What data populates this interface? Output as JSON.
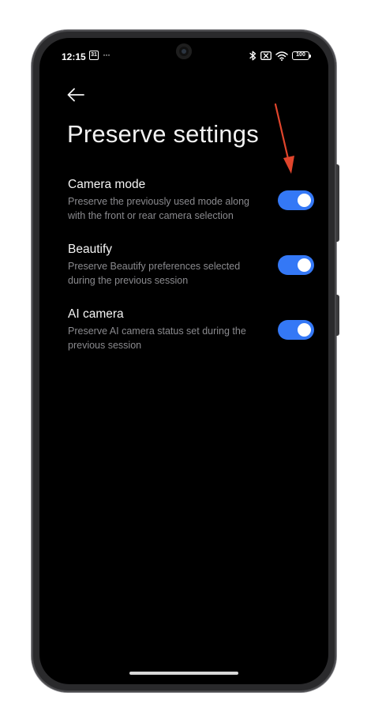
{
  "status_bar": {
    "time": "12:15",
    "calendar_day": "31",
    "more": "···",
    "battery_level": "100"
  },
  "page": {
    "title": "Preserve settings"
  },
  "settings": [
    {
      "title": "Camera mode",
      "description": "Preserve the previously used mode along with the front or rear camera selection",
      "enabled": true
    },
    {
      "title": "Beautify",
      "description": "Preserve Beautify preferences selected during the previous session",
      "enabled": true
    },
    {
      "title": "AI camera",
      "description": "Preserve AI camera status set during the previous session",
      "enabled": true
    }
  ],
  "colors": {
    "toggle_on": "#3478f6",
    "annotation_arrow": "#e0452c",
    "background": "#000000"
  }
}
